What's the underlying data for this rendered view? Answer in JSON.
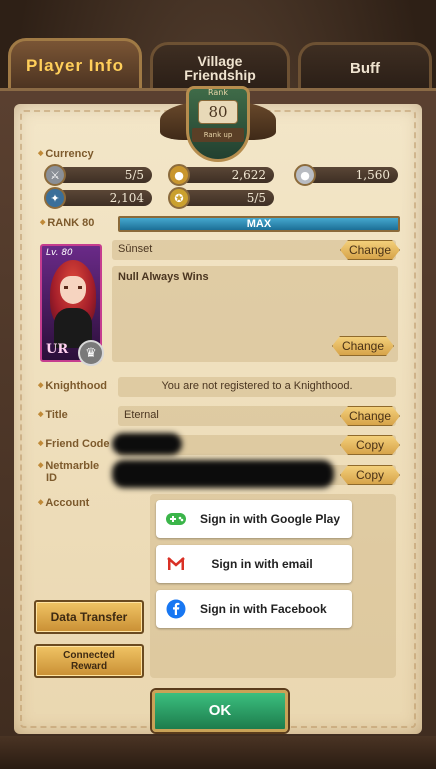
{
  "tabs": {
    "player_info": "Player Info",
    "village_friendship_line1": "Village",
    "village_friendship_line2": "Friendship",
    "buff": "Buff"
  },
  "rank_emblem": {
    "label": "Rank",
    "value": "80",
    "plate": "Rank up"
  },
  "currency": {
    "label": "Currency",
    "items": [
      {
        "icon": "sword-icon",
        "value": "5/5"
      },
      {
        "icon": "gold-coin-icon",
        "value": "2,622"
      },
      {
        "icon": "silver-coin-icon",
        "value": "1,560"
      },
      {
        "icon": "blue-medal-icon",
        "value": "2,104"
      },
      {
        "icon": "gold-medal-icon",
        "value": "5/5"
      }
    ]
  },
  "rank": {
    "label": "RANK 80",
    "bar_text": "MAX",
    "progress": 1.0
  },
  "portrait": {
    "level": "Lv. 80",
    "rarity": "UR"
  },
  "profile": {
    "name": "Sūnset",
    "bio": "Null Always Wins",
    "change_label": "Change"
  },
  "knighthood": {
    "label": "Knighthood",
    "value": "You are not registered to a Knighthood."
  },
  "title": {
    "label": "Title",
    "value": "Eternal",
    "change_label": "Change"
  },
  "friend_code": {
    "label": "Friend Code",
    "copy_label": "Copy"
  },
  "netmarble_id": {
    "label_line1": "Netmarble",
    "label_line2": "ID",
    "copy_label": "Copy"
  },
  "account": {
    "label": "Account",
    "google": "Sign in with Google Play",
    "email": "Sign in with email",
    "facebook": "Sign in with Facebook"
  },
  "buttons": {
    "data_transfer": "Data Transfer",
    "connected_reward_line1": "Connected",
    "connected_reward_line2": "Reward",
    "ok": "OK"
  },
  "colors": {
    "accent_gold": "#ffcf5a",
    "rank_bar": "#2a8ab8",
    "ok_green": "#2aa064",
    "facebook_blue": "#1877f2",
    "gmail_red": "#d93025",
    "google_play_green": "#3bb54a"
  }
}
